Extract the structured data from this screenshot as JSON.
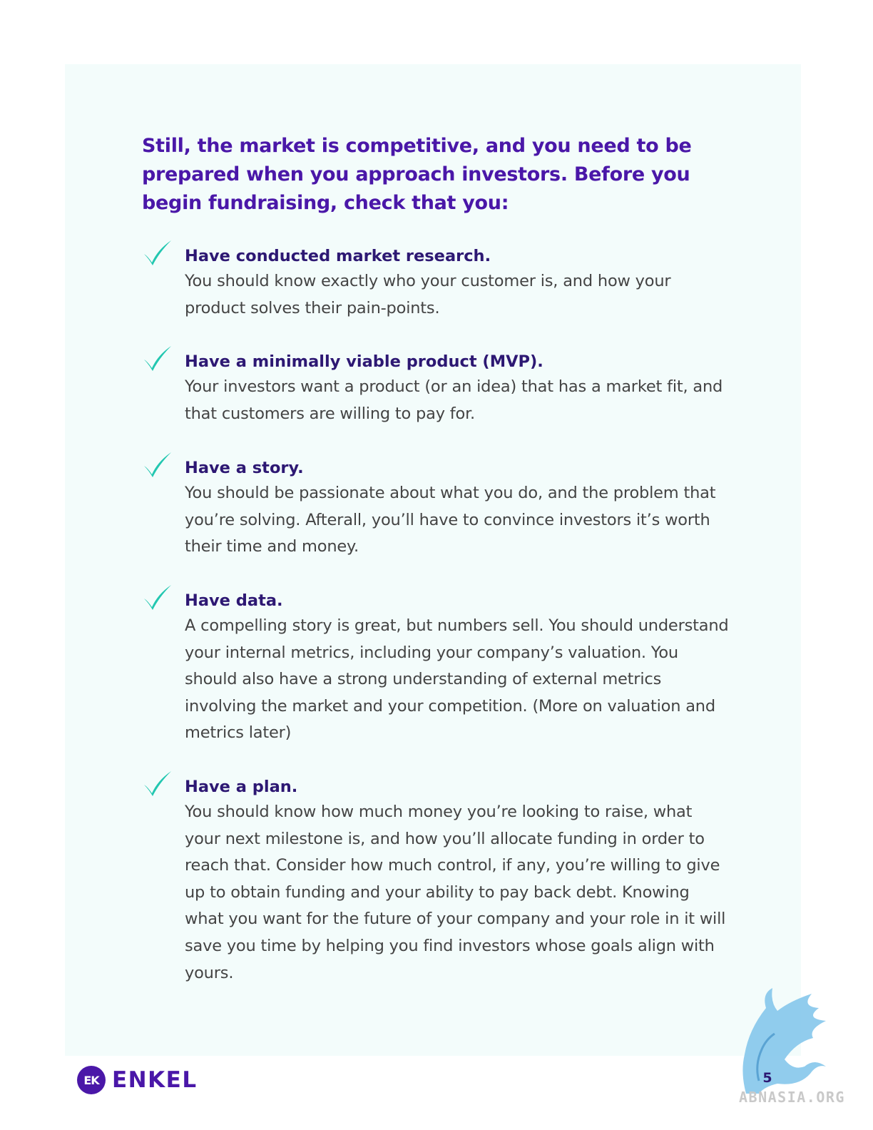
{
  "intro": "Still, the market is competitive, and you need to be prepared when you approach investors. Before you begin fundraising, check that you:",
  "checklist": [
    {
      "icon": "check-icon",
      "title": "Have conducted market research.",
      "body": "You should know exactly who your customer is, and how your product solves their pain-points."
    },
    {
      "icon": "check-icon",
      "title": "Have a minimally viable product (MVP).",
      "body": "Your investors want a product (or an idea) that has a market fit, and that customers are willing to pay for."
    },
    {
      "icon": "check-icon",
      "title": "Have a story.",
      "body": "You should be passionate about what you do, and the problem that you’re solving. Afterall, you’ll have to convince investors it’s worth their time and money."
    },
    {
      "icon": "check-icon",
      "title": "Have data.",
      "body": "A compelling story is great, but numbers sell. You should understand your internal metrics, including your company’s valuation. You should also have a strong understanding of external metrics involving the market and your competition. (More on valuation and metrics later)"
    },
    {
      "icon": "check-icon",
      "title": "Have a plan.",
      "body": "You should know how much money you’re looking to raise, what your next milestone is, and how you’ll allocate funding in order to reach that. Consider how much control, if any, you’re willing to give up to obtain funding and your ability to pay back debt. Knowing what you want for the future of your company and your role in it will save you time by helping you find investors whose goals align with yours."
    }
  ],
  "footer": {
    "logo_mark": "EK",
    "logo_text": "ENKEL",
    "page_number": "5"
  },
  "watermark": {
    "text": "ABNASIA.ORG",
    "icon": "griffin-logo-icon"
  },
  "colors": {
    "panel_background": "#f3fcfb",
    "heading_purple": "#4a17a8",
    "title_navy": "#2d1873",
    "body_text": "#444444",
    "check_teal": "#22c7b0"
  }
}
